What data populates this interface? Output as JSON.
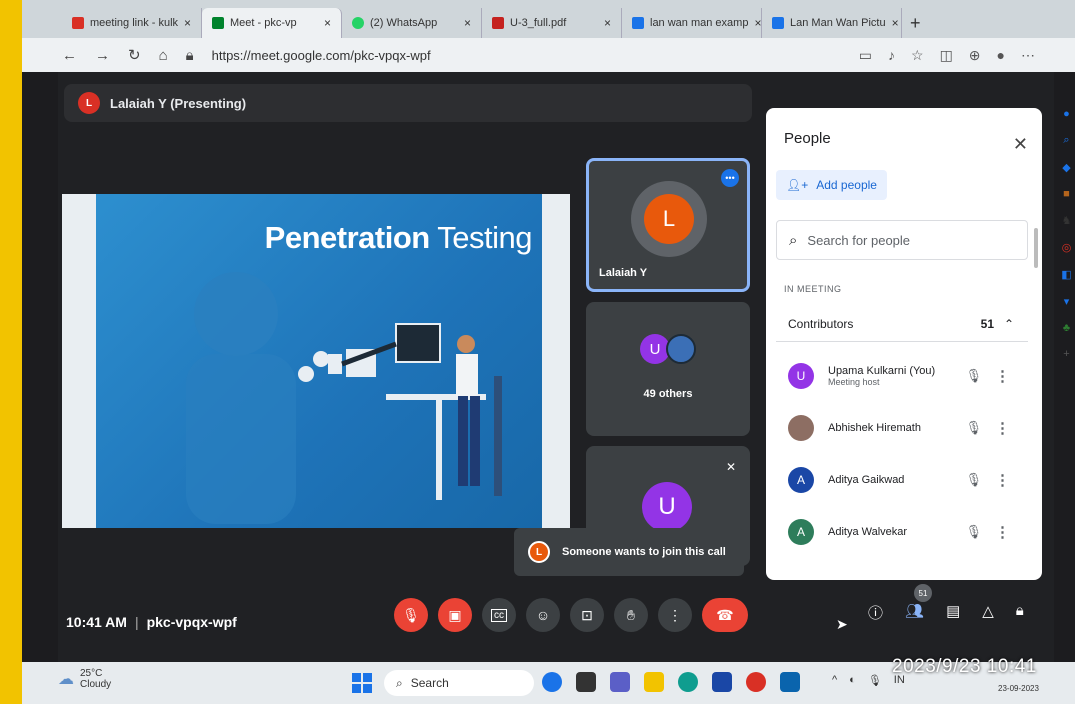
{
  "browser": {
    "tabs": [
      {
        "label": "meeting link - kulk",
        "color": "#d93025"
      },
      {
        "label": "Meet - pkc-vp",
        "color": "#00832d"
      },
      {
        "label": "(2) WhatsApp",
        "color": "#25d366"
      },
      {
        "label": "U-3_full.pdf",
        "color": "#c5221f"
      },
      {
        "label": "lan wan man examp",
        "color": "#1a73e8"
      },
      {
        "label": "Lan Man Wan Pictu",
        "color": "#1a73e8"
      }
    ],
    "url": "https://meet.google.com/pkc-vpqx-wpf"
  },
  "meet": {
    "presenter_initial": "L",
    "presenter_label": "Lalaiah Y (Presenting)",
    "slide": {
      "title_bold": "Penetration",
      "title_light": "Testing"
    },
    "tiles": [
      {
        "initial": "L",
        "name": "Lalaiah Y",
        "color": "#e8590c"
      },
      {
        "initial": "U",
        "name": "49 others",
        "color": "#9334e6"
      },
      {
        "initial": "U",
        "name": "",
        "color": "#9334e6"
      }
    ],
    "toast": {
      "initial": "L",
      "text": "Someone wants to join this call"
    },
    "meeting_time": "10:41 AM",
    "meeting_code": "pkc-vpqx-wpf",
    "people_badge": "51"
  },
  "people_panel": {
    "title": "People",
    "add_people": "Add people",
    "search_placeholder": "Search for people",
    "section": "IN MEETING",
    "contributors_label": "Contributors",
    "contributors_count": "51",
    "people": [
      {
        "initial": "U",
        "name": "Upama Kulkarni (You)",
        "sub": "Meeting host",
        "color": "#9334e6"
      },
      {
        "initial": "",
        "name": "Abhishek Hiremath",
        "sub": "",
        "color": "#8d6e63"
      },
      {
        "initial": "A",
        "name": "Aditya Gaikwad",
        "sub": "",
        "color": "#1a47a6"
      },
      {
        "initial": "A",
        "name": "Aditya Walvekar",
        "sub": "",
        "color": "#2e7d5b"
      }
    ]
  },
  "taskbar": {
    "temperature": "25°C",
    "weather": "Cloudy",
    "search": "Search",
    "clock": "2023/9/23  10:41",
    "lang": "IN",
    "date_small": "23-09-2023"
  }
}
